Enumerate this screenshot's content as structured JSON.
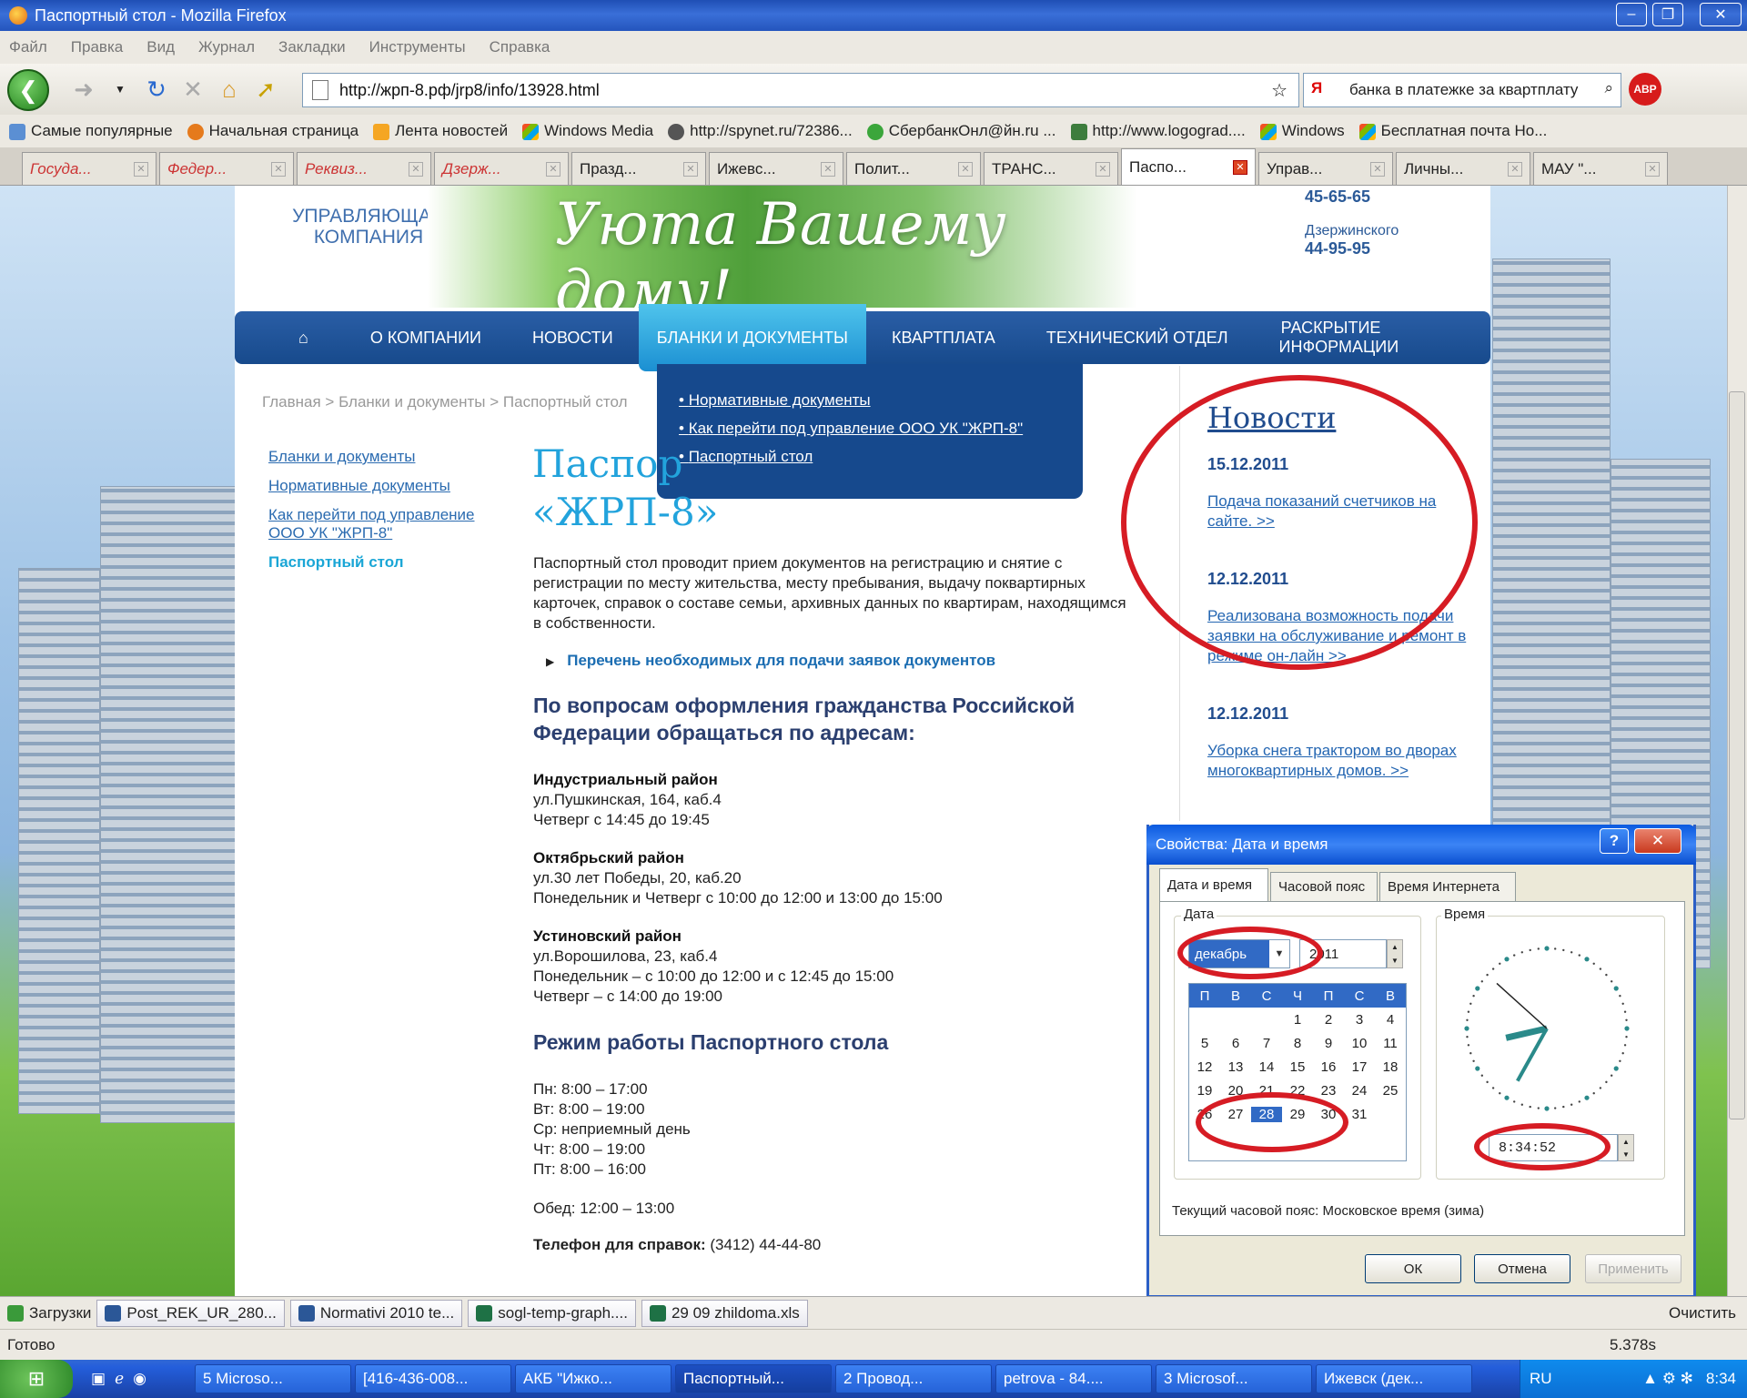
{
  "window": {
    "title": "Паспортный стол - Mozilla Firefox"
  },
  "menu": [
    "Файл",
    "Правка",
    "Вид",
    "Журнал",
    "Закладки",
    "Инструменты",
    "Справка"
  ],
  "url": "http://жрп-8.рф/jrp8/info/13928.html",
  "search": "банка в платежке за квартплату",
  "bookmarks": [
    "Самые популярные",
    "Начальная страница",
    "Лента новостей",
    "Windows Media",
    "http://spynet.ru/72386...",
    "СбербанкОнл@йн.ru ...",
    "http://www.logograd....",
    "Windows",
    "Бесплатная почта Но..."
  ],
  "tabs": [
    "Госуда...",
    "Федер...",
    "Реквиз...",
    "Дзерж...",
    "Празд...",
    "Ижевс...",
    "Полит...",
    "ТРАНС...",
    "Паспо...",
    "Управ...",
    "Личны...",
    "МАУ \"..."
  ],
  "site": {
    "logo": "УПРАВЛЯЮЩАЯ КОМПАНИЯ",
    "slogan": "Уюта Вашему дому!",
    "phone1": "45-65-65",
    "district": "Дзержинского",
    "phone2": "44-95-95",
    "nav": [
      "О КОМПАНИИ",
      "НОВОСТИ",
      "БЛАНКИ И ДОКУМЕНТЫ",
      "КВАРТПЛАТА",
      "ТЕХНИЧЕСКИЙ ОТДЕЛ",
      "РАСКРЫТИЕ ИНФОРМАЦИИ"
    ],
    "dropdown": [
      "Нормативные документы",
      "Как перейти под управление ООО УК \"ЖРП-8\"",
      "Паспортный стол"
    ],
    "breadcrumb": "Главная > Бланки и документы > Паспортный стол",
    "leftmenu": [
      "Бланки и документы",
      "Нормативные документы",
      "Как перейти под управление ООО УК \"ЖРП-8\"",
      "Паспортный стол"
    ],
    "title1": "Паспор",
    "title2": "«ЖРП-8»",
    "intro": "Паспортный стол проводит прием документов на регистрацию и снятие с регистрации по месту жительства, месту пребывания, выдачу поквартирных карточек, справок о составе семьи, архивных данных по квартирам, находящимся в собственности.",
    "listlink": "Перечень необходимых для подачи заявок документов",
    "citizenship": "По вопросам оформления гражданства Российской Федерации обращаться по адресам:",
    "addresses": [
      {
        "name": "Индустриальный район",
        "lines": [
          "ул.Пушкинская, 164, каб.4",
          "Четверг с 14:45 до 19:45"
        ]
      },
      {
        "name": "Октябрьский район",
        "lines": [
          "ул.30 лет Победы, 20, каб.20",
          "Понедельник и Четверг с 10:00 до 12:00 и 13:00 до 15:00"
        ]
      },
      {
        "name": "Устиновский район",
        "lines": [
          "ул.Ворошилова, 23, каб.4",
          "Понедельник – с 10:00 до 12:00 и с 12:45 до 15:00",
          "Четверг – с 14:00 до 19:00"
        ]
      }
    ],
    "hours_title": "Режим работы Паспортного стола",
    "hours": [
      "Пн: 8:00 – 17:00",
      "Вт: 8:00 – 19:00",
      "Ср: неприемный день",
      "Чт: 8:00 – 19:00",
      "Пт: 8:00 – 16:00"
    ],
    "lunch": "Обед: 12:00 – 13:00",
    "phone_label": "Телефон для справок:",
    "phone_value": " (3412) 44-44-80",
    "news_title": "Новости",
    "news": [
      {
        "date": "15.12.2011",
        "text": "Подача показаний счетчиков на сайте. >>"
      },
      {
        "date": "12.12.2011",
        "text": "Реализована возможность подачи заявки на обслуживание и ремонт в режиме он-лайн >>"
      },
      {
        "date": "12.12.2011",
        "text": "Уборка снега трактором во дворах многоквартирных домов. >>"
      }
    ]
  },
  "dialog": {
    "title": "Свойства: Дата и время",
    "tabs": [
      "Дата и время",
      "Часовой пояс",
      "Время Интернета"
    ],
    "date_label": "Дата",
    "time_label": "Время",
    "month": "декабрь",
    "year": "2011",
    "weekdays": [
      "П",
      "В",
      "С",
      "Ч",
      "П",
      "С",
      "В"
    ],
    "weeks": [
      [
        "",
        "",
        "",
        "1",
        "2",
        "3",
        "4"
      ],
      [
        "5",
        "6",
        "7",
        "8",
        "9",
        "10",
        "11"
      ],
      [
        "12",
        "13",
        "14",
        "15",
        "16",
        "17",
        "18"
      ],
      [
        "19",
        "20",
        "21",
        "22",
        "23",
        "24",
        "25"
      ],
      [
        "26",
        "27",
        "28",
        "29",
        "30",
        "31",
        ""
      ]
    ],
    "selected_day": "28",
    "time": "8:34:52",
    "timezone": "Текущий часовой пояс: Московское время (зима)",
    "ok": "ОК",
    "cancel": "Отмена",
    "apply": "Применить"
  },
  "downloads": {
    "label": "Загрузки",
    "items": [
      "Post_REK_UR_280...",
      "Normativi 2010 te...",
      "sogl-temp-graph....",
      "29 09 zhildoma.xls"
    ],
    "clear": "Очистить"
  },
  "status": {
    "text": "Готово",
    "speed": "5.378s"
  },
  "taskbar": {
    "items": [
      "5 Microso...",
      "[416-436-008...",
      "АКБ \"Ижко...",
      "Паспортный...",
      "2 Провод...",
      "petrova - 84....",
      "3 Microsof...",
      "Ижевск (дек..."
    ],
    "lang": "RU",
    "clock": "8:34"
  }
}
